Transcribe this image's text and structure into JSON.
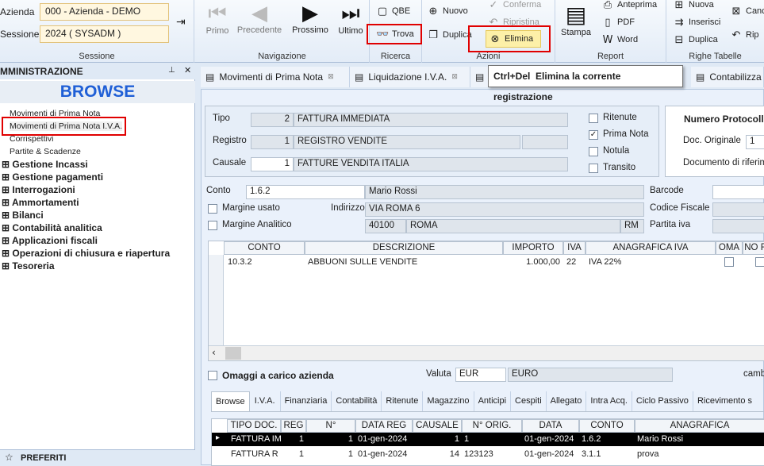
{
  "session": {
    "azienda_label": "Azienda",
    "azienda_value": "000 - Azienda - DEMO",
    "sessione_label": "Sessione",
    "sessione_value": "2024 ( SYSADM )",
    "group_label": "Sessione"
  },
  "navigation": {
    "primo": "Primo",
    "precedente": "Precedente",
    "prossimo": "Prossimo",
    "ultimo": "Ultimo",
    "group_label": "Navigazione"
  },
  "ricerca": {
    "qbe": "QBE",
    "trova": "Trova",
    "group_label": "Ricerca"
  },
  "azioni": {
    "nuovo": "Nuovo",
    "duplica": "Duplica",
    "conferma": "Conferma",
    "ripristina": "Ripristina",
    "elimina": "Elimina",
    "group_label": "Azioni"
  },
  "report": {
    "stampa": "Stampa",
    "anteprima": "Anteprima",
    "pdf": "PDF",
    "word": "Word",
    "group_label": "Report"
  },
  "righe": {
    "nuova": "Nuova",
    "inserisci": "Inserisci",
    "duplica": "Duplica",
    "canc": "Canc",
    "rip": "Rip",
    "group_label": "Righe Tabelle"
  },
  "tooltip": {
    "shortcut": "Ctrl+Del",
    "text": "Elimina la corrente registrazione"
  },
  "left_panel": {
    "title": "MMINISTRAZIONE",
    "browse": "BROWSE",
    "items": [
      "Movimenti di Prima Nota",
      "Movimenti di Prima Nota I.V.A.",
      "Corrispettivi",
      "Partite & Scadenze",
      "Gestione Incassi",
      "Gestione pagamenti",
      "Interrogazioni",
      "Ammortamenti",
      "Bilanci",
      "Contabilità analitica",
      "Applicazioni fiscali",
      "Operazioni di chiusura e riapertura",
      "Tesoreria"
    ],
    "preferiti": "PREFERITI"
  },
  "doc_tabs": [
    "Movimenti di Prima Nota",
    "Liquidazione I.V.A.",
    "Contabilizza"
  ],
  "form": {
    "tipo_label": "Tipo",
    "tipo_num": "2",
    "tipo_desc": "FATTURA IMMEDIATA",
    "registro_label": "Registro",
    "registro_num": "1",
    "registro_desc": "REGISTRO VENDITE",
    "causale_label": "Causale",
    "causale_num": "1",
    "causale_desc": "FATTURE VENDITA ITALIA",
    "ritenute": "Ritenute",
    "prima_nota": "Prima Nota",
    "notula": "Notula",
    "transito": "Transito",
    "numero_protocollo": "Numero Protocollo",
    "doc_originale": "Doc. Originale",
    "doc_originale_val": "1",
    "doc_riferimento": "Documento di riferime",
    "conto_label": "Conto",
    "conto_val": "1.6.2",
    "conto_nome": "Mario Rossi",
    "margine_usato": "Margine usato",
    "indirizzo_label": "Indirizzo",
    "indirizzo_val": "VIA ROMA 6",
    "margine_analitico": "Margine Analitico",
    "cap": "40100",
    "citta": "ROMA",
    "prov": "RM",
    "barcode": "Barcode",
    "codice_fiscale": "Codice Fiscale",
    "partita_iva": "Partita iva"
  },
  "grid": {
    "headers": [
      "CONTO",
      "DESCRIZIONE",
      "IMPORTO",
      "IVA",
      "ANAGRAFICA IVA",
      "OMA",
      "NO F"
    ],
    "row": [
      "10.3.2",
      "ABBUONI SULLE VENDITE",
      "1.000,00",
      "22",
      "IVA 22%"
    ]
  },
  "bottom": {
    "omaggi": "Omaggi a carico azienda",
    "valuta_label": "Valuta",
    "valuta_code": "EUR",
    "valuta_desc": "EURO",
    "cambio": "camb"
  },
  "sub_tabs": [
    "Browse",
    "I.V.A.",
    "Finanziaria",
    "Contabilità",
    "Ritenute",
    "Magazzino",
    "Anticipi",
    "Cespiti",
    "Allegato",
    "Intra Acq.",
    "Ciclo Passivo",
    "Ricevimento s"
  ],
  "browse_grid": {
    "headers": [
      "TIPO DOC.",
      "REG",
      "N°",
      "DATA REG",
      "CAUSALE",
      "N° ORIG.",
      "DATA",
      "CONTO",
      "ANAGRAFICA"
    ],
    "rows": [
      [
        "FATTURA IM",
        "1",
        "1",
        "01-gen-2024",
        "1",
        "1",
        "01-gen-2024",
        "1.6.2",
        "Mario Rossi"
      ],
      [
        "FATTURA R",
        "1",
        "1",
        "01-gen-2024",
        "14",
        "123123",
        "01-gen-2024",
        "3.1.1",
        "prova"
      ]
    ]
  }
}
